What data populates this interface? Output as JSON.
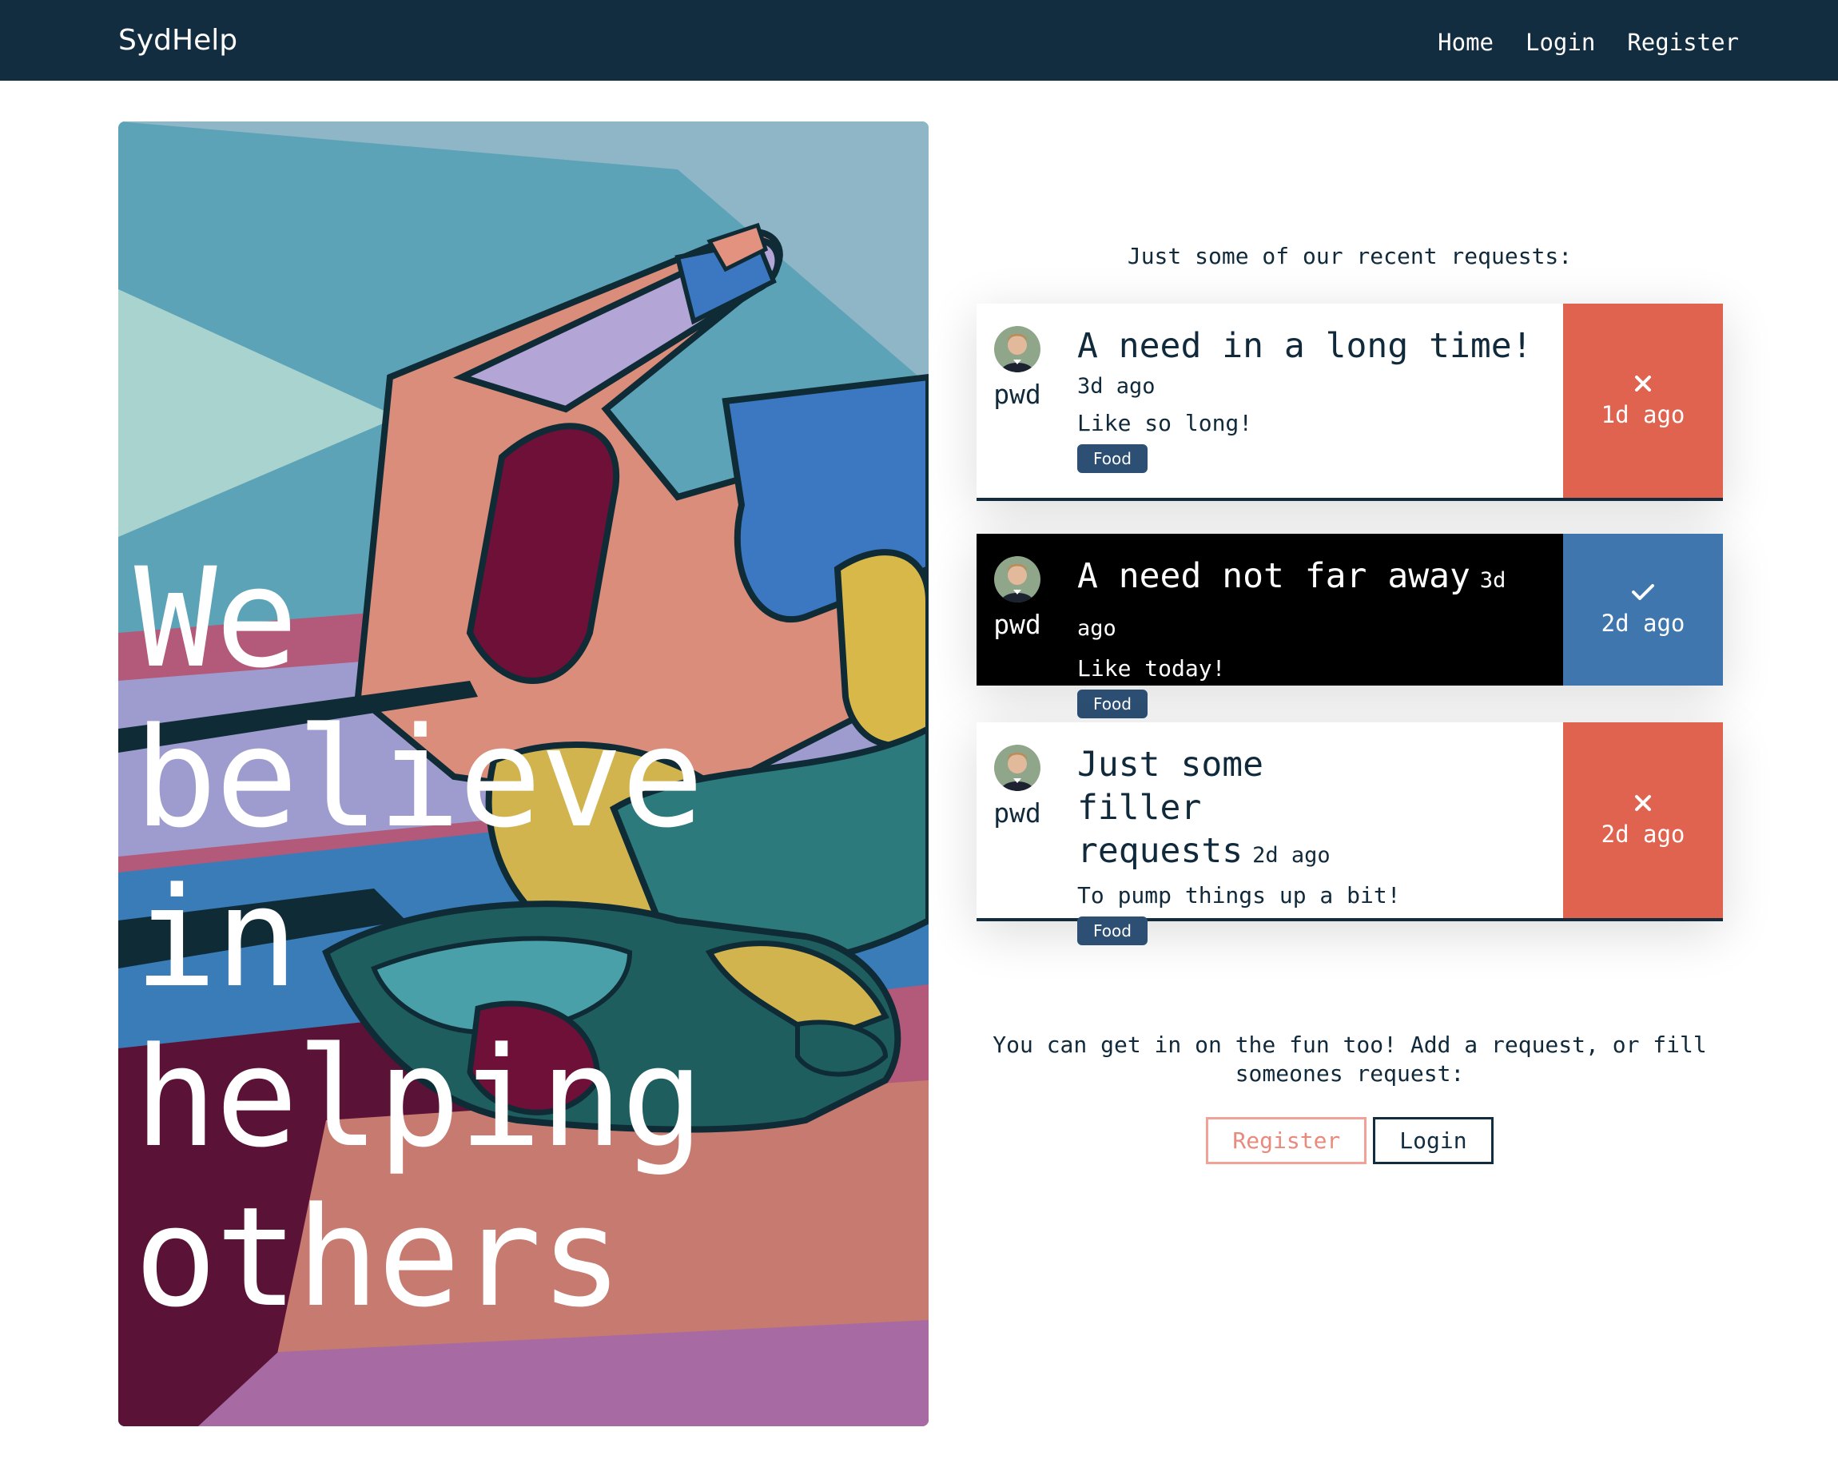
{
  "nav": {
    "brand": "SydHelp",
    "links": [
      "Home",
      "Login",
      "Register"
    ]
  },
  "hero": {
    "headline_lines": [
      "We believe",
      "in helping",
      "others"
    ]
  },
  "requests": {
    "intro": "Just some of our recent requests:",
    "items": [
      {
        "user": "pwd",
        "title": "A need in a long time!",
        "posted": "3d ago",
        "description": "Like so long!",
        "tag": "Food",
        "status_icon": "close-icon",
        "status_time": "1d ago",
        "status_color": "#e0634f"
      },
      {
        "user": "pwd",
        "title": "A need not far away",
        "posted": "3d ago",
        "description": "Like today!",
        "tag": "Food",
        "status_icon": "check-icon",
        "status_time": "2d ago",
        "status_color": "#3e76ad"
      },
      {
        "user": "pwd",
        "title": "Just some filler requests",
        "posted": "2d ago",
        "description": "To pump things up a bit!",
        "tag": "Food",
        "status_icon": "close-icon",
        "status_time": "2d ago",
        "status_color": "#e0634f"
      }
    ]
  },
  "cta": {
    "text": "You can get in on the fun too! Add a request, or fill someones request:",
    "register_label": "Register",
    "login_label": "Login"
  },
  "colors": {
    "navbar": "#122d40",
    "accent_red": "#e0634f",
    "accent_blue": "#3e76ad",
    "badge": "#2c4f73"
  }
}
